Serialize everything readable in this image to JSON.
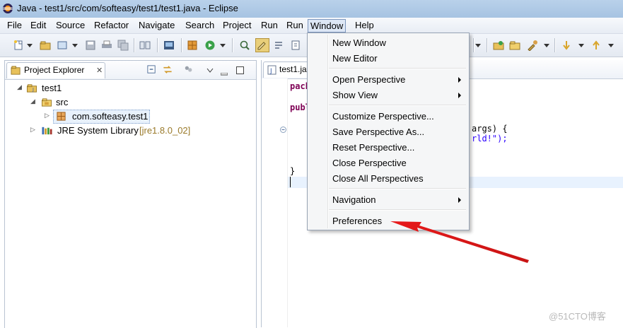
{
  "window": {
    "title": "Java - test1/src/com/softeasy/test1/test1.java - Eclipse"
  },
  "menubar": {
    "items": [
      "File",
      "Edit",
      "Source",
      "Refactor",
      "Navigate",
      "Search",
      "Project",
      "Run",
      "Run",
      "Window",
      "Help"
    ],
    "active": "Window"
  },
  "project_explorer": {
    "tab_label": "Project Explorer",
    "close_glyph": "✕",
    "tree": [
      {
        "label": "test1",
        "icon": "java-project-icon",
        "expanded": true
      },
      {
        "label": "src",
        "icon": "source-folder-icon",
        "expanded": true
      },
      {
        "label": "com.softeasy.test1",
        "icon": "package-icon",
        "expanded": false,
        "selected": true
      },
      {
        "label": "JRE System Library",
        "decoration": "[jre1.8.0_02]",
        "icon": "library-icon",
        "expanded": false
      }
    ]
  },
  "editor": {
    "tab_label": "test1.java",
    "code_fragments": {
      "line1": "pack",
      "line2": "publ",
      "line3_end": "args) {",
      "line4_end": "rld!\");",
      "line5": "}"
    }
  },
  "window_menu": {
    "items": [
      {
        "label": "New Window",
        "submenu": false
      },
      {
        "label": "New Editor",
        "submenu": false
      },
      {
        "label": "Open Perspective",
        "submenu": true
      },
      {
        "label": "Show View",
        "submenu": true
      },
      {
        "label": "Customize Perspective...",
        "submenu": false
      },
      {
        "label": "Save Perspective As...",
        "submenu": false
      },
      {
        "label": "Reset Perspective...",
        "submenu": false
      },
      {
        "label": "Close Perspective",
        "submenu": false
      },
      {
        "label": "Close All Perspectives",
        "submenu": false
      },
      {
        "label": "Navigation",
        "submenu": true
      },
      {
        "label": "Preferences",
        "submenu": false
      }
    ]
  },
  "annotation": {
    "arrow_color": "#e8191a",
    "points_to": "Preferences"
  },
  "watermark": "@51CTO博客",
  "colors": {
    "titlebar": "#b9d1ea",
    "menu_bg": "#f5f6f7",
    "keyword": "#7f0055",
    "string": "#2a00ff",
    "selection": "#e8f1fc"
  }
}
